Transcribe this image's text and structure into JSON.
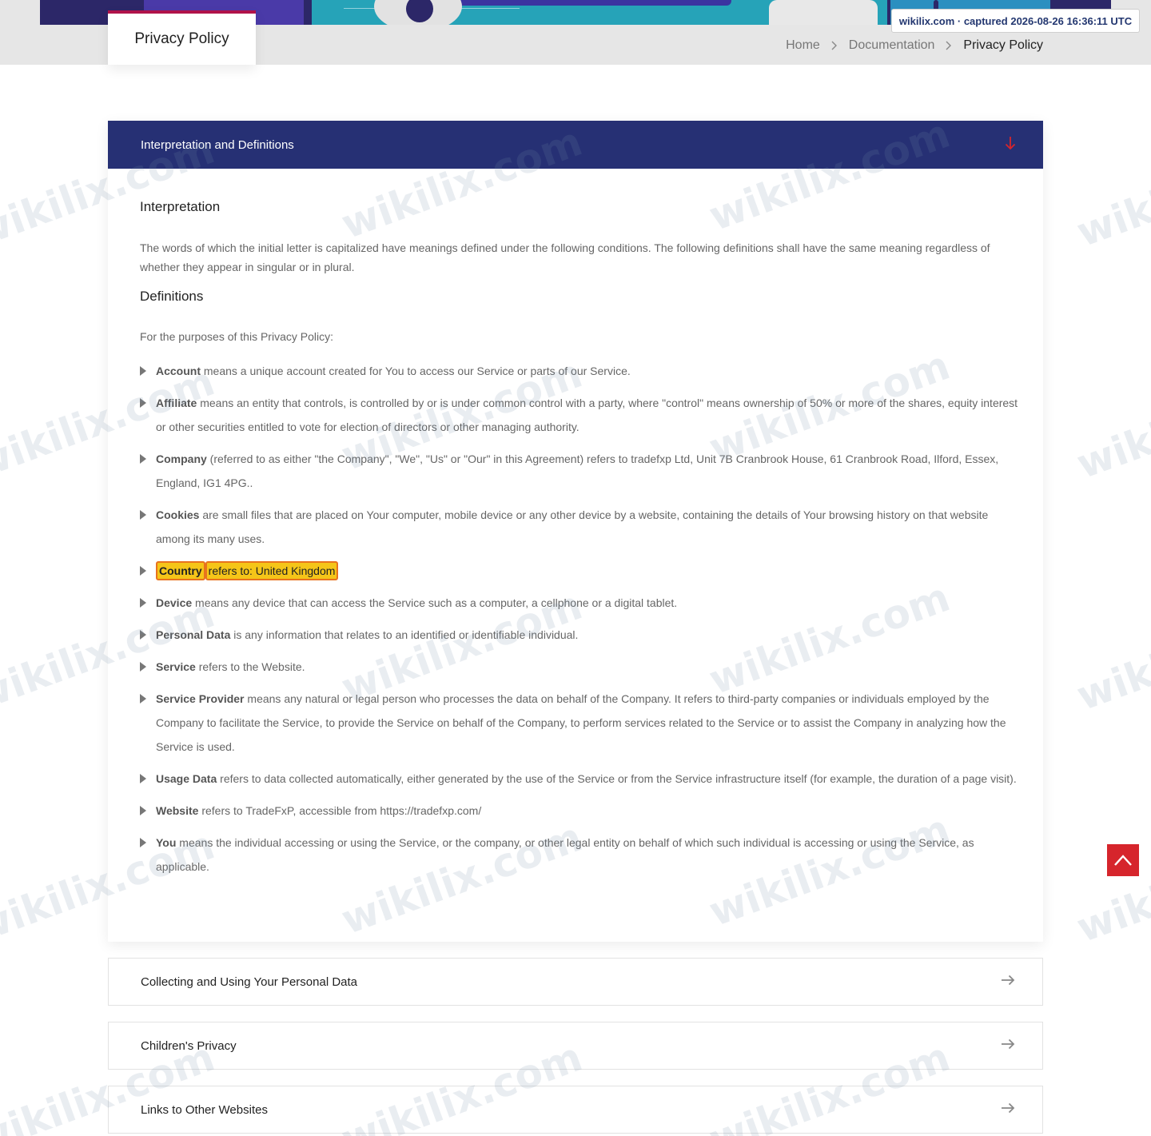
{
  "page": {
    "title": "Privacy Policy",
    "capture_badge": "wikilix.com · captured 2026-08-26 16:36:11 UTC"
  },
  "breadcrumb": {
    "items": [
      "Home",
      "Documentation",
      "Privacy Policy"
    ]
  },
  "section_open": {
    "title": "Interpretation and Definitions",
    "interpretation_heading": "Interpretation",
    "interpretation_text": "The words of which the initial letter is capitalized have meanings defined under the following conditions. The following definitions shall have the same meaning regardless of whether they appear in singular or in plural.",
    "definitions_heading": "Definitions",
    "definitions_intro": "For the purposes of this Privacy Policy:",
    "definitions": [
      {
        "term": "Account",
        "text": " means a unique account created for You to access our Service or parts of our Service."
      },
      {
        "term": "Affiliate",
        "text": " means an entity that controls, is controlled by or is under common control with a party, where \"control\" means ownership of 50% or more of the shares, equity interest or other securities entitled to vote for election of directors or other managing authority."
      },
      {
        "term": "Company",
        "text": " (referred to as either \"the Company\", \"We\", \"Us\" or \"Our\" in this Agreement) refers to tradefxp Ltd, Unit 7B Cranbrook House, 61 Cranbrook Road, Ilford, Essex, England, IG1 4PG.."
      },
      {
        "term": "Cookies",
        "text": " are small files that are placed on Your computer, mobile device or any other device by a website, containing the details of Your browsing history on that website among its many uses."
      },
      {
        "term": "Country",
        "text": "refers to: United Kingdom"
      },
      {
        "term": "Device",
        "text": " means any device that can access the Service such as a computer, a cellphone or a digital tablet."
      },
      {
        "term": "Personal Data",
        "text": " is any information that relates to an identified or identifiable individual."
      },
      {
        "term": "Service",
        "text": " refers to the Website."
      },
      {
        "term": "Service Provider",
        "text": " means any natural or legal person who processes the data on behalf of the Company. It refers to third-party companies or individuals employed by the Company to facilitate the Service, to provide the Service on behalf of the Company, to perform services related to the Service or to assist the Company in analyzing how the Service is used."
      },
      {
        "term": "Usage Data",
        "text": " refers to data collected automatically, either generated by the use of the Service or from the Service infrastructure itself (for example, the duration of a page visit)."
      },
      {
        "term": "Website",
        "text": " refers to TradeFxP, accessible from https://tradefxp.com/"
      },
      {
        "term": "You",
        "text": " means the individual accessing or using the Service, or the company, or other legal entity on behalf of which such individual is accessing or using the Service, as applicable."
      }
    ]
  },
  "sections_collapsed": [
    {
      "title": "Collecting and Using Your Personal Data"
    },
    {
      "title": "Children's Privacy"
    },
    {
      "title": "Links to Other Websites"
    }
  ],
  "watermark": "wikilix.com",
  "colors": {
    "header_bar": "#263074",
    "accent_red": "#d6252c",
    "highlight": "#f5c518",
    "highlight_border": "#e8731e",
    "title_card_border": "#b0134a"
  }
}
